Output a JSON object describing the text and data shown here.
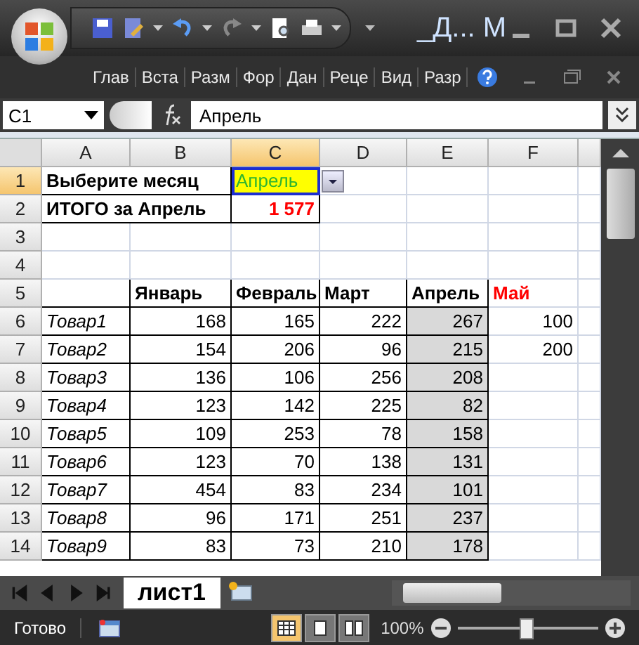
{
  "title_bar": {
    "title": "_Д... М"
  },
  "ribbon_tabs": [
    "Глав",
    "Вста",
    "Разм",
    "Фор",
    "Дан",
    "Реце",
    "Вид",
    "Разр"
  ],
  "formula_bar": {
    "name_box": "C1",
    "formula": "Апрель"
  },
  "columns": [
    {
      "label": "A",
      "selected": false
    },
    {
      "label": "B",
      "selected": false
    },
    {
      "label": "C",
      "selected": true
    },
    {
      "label": "D",
      "selected": false
    },
    {
      "label": "E",
      "selected": false
    },
    {
      "label": "F",
      "selected": false
    }
  ],
  "rows": [
    {
      "num": "1",
      "selected": true,
      "cells": [
        {
          "kind": "label",
          "text": "Выберите месяц"
        },
        {
          "kind": "input",
          "text": "Апрель"
        },
        {
          "kind": "empty"
        },
        {
          "kind": "empty"
        },
        {
          "kind": "empty"
        }
      ]
    },
    {
      "num": "2",
      "selected": false,
      "cells": [
        {
          "kind": "label",
          "text": "ИТОГО за Апрель"
        },
        {
          "kind": "result",
          "text": "1 577"
        },
        {
          "kind": "empty"
        },
        {
          "kind": "empty"
        },
        {
          "kind": "empty"
        }
      ]
    },
    {
      "num": "3",
      "selected": false,
      "cells": [
        {
          "kind": "empty"
        },
        {
          "kind": "empty"
        },
        {
          "kind": "empty"
        },
        {
          "kind": "empty"
        },
        {
          "kind": "empty"
        },
        {
          "kind": "empty"
        }
      ]
    },
    {
      "num": "4",
      "selected": false,
      "cells": [
        {
          "kind": "empty"
        },
        {
          "kind": "empty"
        },
        {
          "kind": "empty"
        },
        {
          "kind": "empty"
        },
        {
          "kind": "empty"
        },
        {
          "kind": "empty"
        }
      ]
    },
    {
      "num": "5",
      "selected": false,
      "cells": [
        {
          "kind": "frame"
        },
        {
          "kind": "header",
          "text": "Январь"
        },
        {
          "kind": "header",
          "text": "Февраль"
        },
        {
          "kind": "header",
          "text": "Март"
        },
        {
          "kind": "header",
          "text": "Апрель"
        },
        {
          "kind": "alert",
          "text": "Май"
        }
      ]
    },
    {
      "num": "6",
      "selected": false,
      "cells": [
        {
          "kind": "item",
          "text": "Товар1"
        },
        {
          "kind": "number",
          "text": "168"
        },
        {
          "kind": "number",
          "text": "165"
        },
        {
          "kind": "number",
          "text": "222"
        },
        {
          "kind": "shaded",
          "text": "267"
        },
        {
          "kind": "plain",
          "text": "100"
        }
      ]
    },
    {
      "num": "7",
      "selected": false,
      "cells": [
        {
          "kind": "item",
          "text": "Товар2"
        },
        {
          "kind": "number",
          "text": "154"
        },
        {
          "kind": "number",
          "text": "206"
        },
        {
          "kind": "number",
          "text": "96"
        },
        {
          "kind": "shaded",
          "text": "215"
        },
        {
          "kind": "plain",
          "text": "200"
        }
      ]
    },
    {
      "num": "8",
      "selected": false,
      "cells": [
        {
          "kind": "item",
          "text": "Товар3"
        },
        {
          "kind": "number",
          "text": "136"
        },
        {
          "kind": "number",
          "text": "106"
        },
        {
          "kind": "number",
          "text": "256"
        },
        {
          "kind": "shaded",
          "text": "208"
        },
        {
          "kind": "empty"
        }
      ]
    },
    {
      "num": "9",
      "selected": false,
      "cells": [
        {
          "kind": "item",
          "text": "Товар4"
        },
        {
          "kind": "number",
          "text": "123"
        },
        {
          "kind": "number",
          "text": "142"
        },
        {
          "kind": "number",
          "text": "225"
        },
        {
          "kind": "shaded",
          "text": "82"
        },
        {
          "kind": "empty"
        }
      ]
    },
    {
      "num": "10",
      "selected": false,
      "cells": [
        {
          "kind": "item",
          "text": "Товар5"
        },
        {
          "kind": "number",
          "text": "109"
        },
        {
          "kind": "number",
          "text": "253"
        },
        {
          "kind": "number",
          "text": "78"
        },
        {
          "kind": "shaded",
          "text": "158"
        },
        {
          "kind": "empty"
        }
      ]
    },
    {
      "num": "11",
      "selected": false,
      "cells": [
        {
          "kind": "item",
          "text": "Товар6"
        },
        {
          "kind": "number",
          "text": "123"
        },
        {
          "kind": "number",
          "text": "70"
        },
        {
          "kind": "number",
          "text": "138"
        },
        {
          "kind": "shaded",
          "text": "131"
        },
        {
          "kind": "empty"
        }
      ]
    },
    {
      "num": "12",
      "selected": false,
      "cells": [
        {
          "kind": "item",
          "text": "Товар7"
        },
        {
          "kind": "number",
          "text": "454"
        },
        {
          "kind": "number",
          "text": "83"
        },
        {
          "kind": "number",
          "text": "234"
        },
        {
          "kind": "shaded",
          "text": "101"
        },
        {
          "kind": "empty"
        }
      ]
    },
    {
      "num": "13",
      "selected": false,
      "cells": [
        {
          "kind": "item",
          "text": "Товар8"
        },
        {
          "kind": "number",
          "text": "96"
        },
        {
          "kind": "number",
          "text": "171"
        },
        {
          "kind": "number",
          "text": "251"
        },
        {
          "kind": "shaded",
          "text": "237"
        },
        {
          "kind": "empty"
        }
      ]
    },
    {
      "num": "14",
      "selected": false,
      "cells": [
        {
          "kind": "item",
          "text": "Товар9"
        },
        {
          "kind": "number",
          "text": "83"
        },
        {
          "kind": "number",
          "text": "73"
        },
        {
          "kind": "number",
          "text": "210"
        },
        {
          "kind": "shaded",
          "text": "178"
        },
        {
          "kind": "empty"
        }
      ]
    }
  ],
  "sheet_tabs": [
    {
      "label": "лист1",
      "selected": true
    }
  ],
  "status_bar": {
    "status": "Готово",
    "zoom": "100%",
    "views": [
      {
        "kind": "normal",
        "selected": true
      },
      {
        "kind": "layout",
        "selected": false
      },
      {
        "kind": "pagebreak",
        "selected": false
      }
    ],
    "zoom_slider": {
      "level": 0.48
    }
  }
}
